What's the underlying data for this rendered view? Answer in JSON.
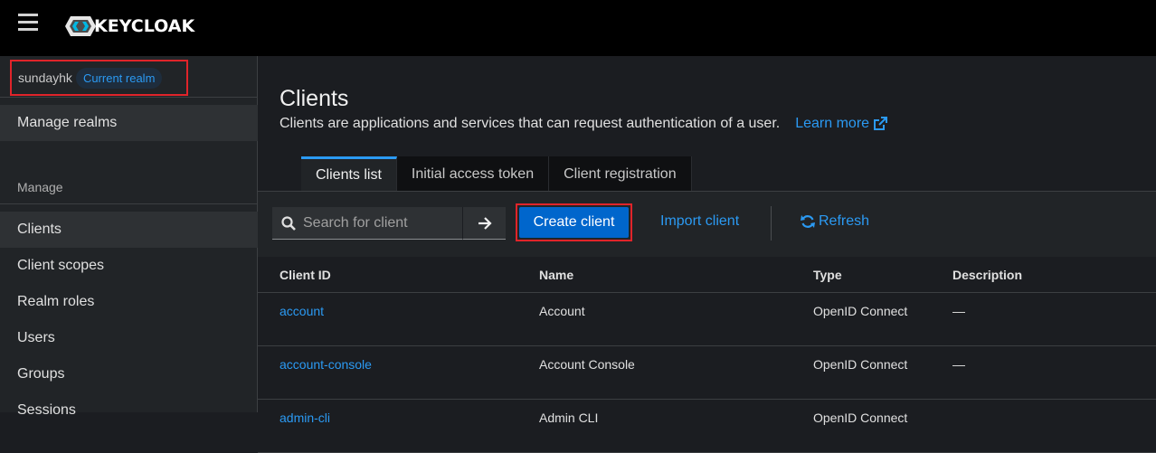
{
  "masthead": {
    "brand": "KEYCLOAK"
  },
  "sidebar": {
    "realm_name": "sundayhk",
    "realm_badge": "Current realm",
    "manage_realms": "Manage realms",
    "section_label": "Manage",
    "items": [
      {
        "label": "Clients"
      },
      {
        "label": "Client scopes"
      },
      {
        "label": "Realm roles"
      },
      {
        "label": "Users"
      },
      {
        "label": "Groups"
      },
      {
        "label": "Sessions"
      }
    ]
  },
  "main": {
    "title": "Clients",
    "description": "Clients are applications and services that can request authentication of a user.",
    "learn_more": "Learn more",
    "tabs": [
      {
        "label": "Clients list"
      },
      {
        "label": "Initial access token"
      },
      {
        "label": "Client registration"
      }
    ],
    "search_placeholder": "Search for client",
    "create_label": "Create client",
    "import_label": "Import client",
    "refresh_label": "Refresh"
  },
  "table": {
    "headers": [
      "Client ID",
      "Name",
      "Type",
      "Description"
    ],
    "rows": [
      {
        "id": "account",
        "name": "Account",
        "type": "OpenID Connect",
        "description": "—"
      },
      {
        "id": "account-console",
        "name": "Account Console",
        "type": "OpenID Connect",
        "description": "—"
      },
      {
        "id": "admin-cli",
        "name": "Admin CLI",
        "type": "OpenID Connect",
        "description": ""
      }
    ]
  },
  "colors": {
    "accent": "#2b9af3",
    "primary_button": "#0066cc",
    "highlight": "#e0242a"
  }
}
